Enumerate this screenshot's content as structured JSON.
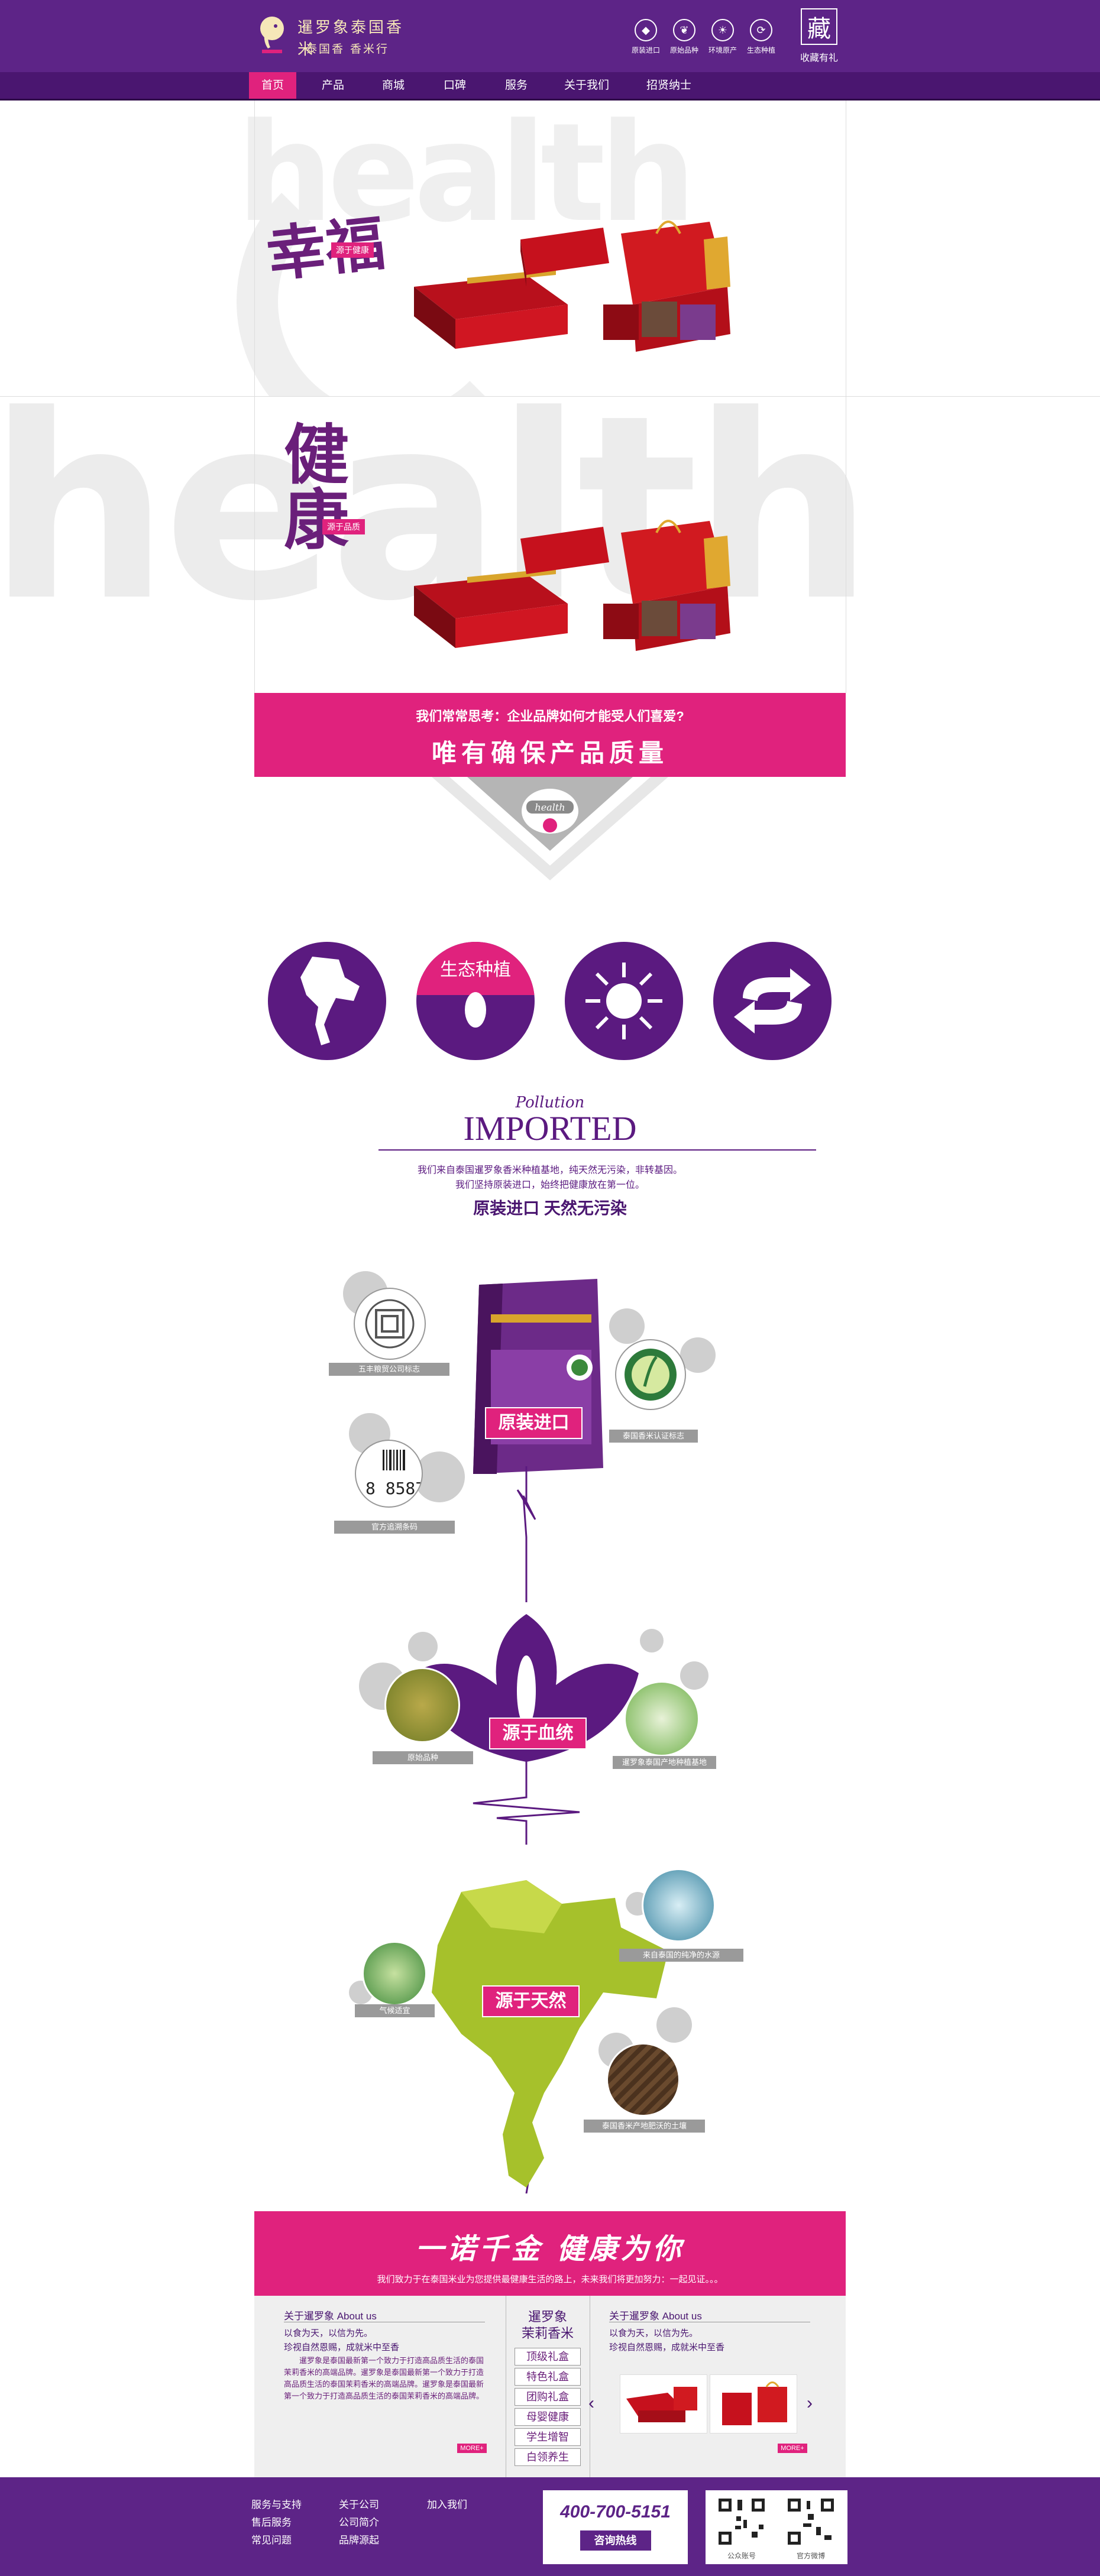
{
  "header": {
    "logo_title": "暹罗象泰国香米",
    "logo_sub": "泰国香 香米行",
    "icons": [
      {
        "icon": "rice-icon",
        "label": "原装进口"
      },
      {
        "icon": "leaf-icon",
        "label": "原始品种"
      },
      {
        "icon": "sun-icon",
        "label": "环境原产"
      },
      {
        "icon": "cycle-icon",
        "label": "生态种植"
      }
    ],
    "fav_glyph": "藏",
    "fav_label": "收藏有礼"
  },
  "nav": [
    "首页",
    "产品",
    "商城",
    "口碑",
    "服务",
    "关于我们",
    "招贤纳士"
  ],
  "banner1": {
    "bg_text": "health",
    "calligraphy": "幸福",
    "tag": "源于健康"
  },
  "banner2": {
    "bg_text": "health",
    "calligraphy": "健康",
    "tag": "源于品质"
  },
  "slogan": {
    "line1": "我们常常思考：企业品牌如何才能受人们喜爱?",
    "line2": "唯有确保产品质量"
  },
  "badge_text": "health",
  "circles": [
    {
      "icon": "thailand-map-icon",
      "label": ""
    },
    {
      "icon": "rice-grain-icon",
      "label": "生态种植"
    },
    {
      "icon": "sun-icon",
      "label": ""
    },
    {
      "icon": "recycle-arrows-icon",
      "label": ""
    }
  ],
  "imported": {
    "script": "Pollution",
    "title": "IMPORTED",
    "desc1": "我们来自泰国暹罗象香米种植基地，纯天然无污染，非转基因。",
    "desc2": "我们坚持原装进口，始终把健康放在第一位。",
    "headline": "原装进口 天然无污染"
  },
  "flow": {
    "sec1_button": "原装进口",
    "sec1_labels": [
      "五丰粮贸公司标志",
      "泰国香米认证标志",
      "官方追溯条码"
    ],
    "barcode_number": "8 8587",
    "sec2_button": "源于血统",
    "sec2_labels": [
      "原始品种",
      "暹罗象泰国产地种植基地"
    ],
    "sec3_button": "源于天然",
    "sec3_labels": [
      "来自泰国的纯净的水源",
      "气候适宜",
      "泰国香米产地肥沃的土壤"
    ]
  },
  "bottom_banner": {
    "title": "一诺千金 健康为你",
    "sub": "我们致力于在泰国米业为您提供最健康生活的路上，未来我们将更加努力：一起见证。。。"
  },
  "about_left": {
    "title": "关于暹罗象 About us",
    "line1": "以食为天，以信为先。",
    "line2": "珍视自然恩赐，成就米中至香",
    "para": "暹罗象是泰国最新第一个致力于打造高品质生活的泰国茉莉香米的高端品牌。暹罗象是泰国最新第一个致力于打造高品质生活的泰国茉莉香米的高端品牌。暹罗象是泰国最新第一个致力于打造高品质生活的泰国茉莉香米的高端品牌。",
    "more": "MORE+"
  },
  "menu": {
    "title1": "暹罗象",
    "title2": "茉莉香米",
    "items": [
      "顶级礼盒",
      "特色礼盒",
      "团购礼盒",
      "母婴健康",
      "学生增智",
      "白领养生"
    ]
  },
  "about_right": {
    "title": "关于暹罗象 About us",
    "line1": "以食为天，以信为先。",
    "line2": "珍视自然恩赐，成就米中至香",
    "more": "MORE+"
  },
  "footer": {
    "col1": [
      "服务与支持",
      "售后服务",
      "常见问题"
    ],
    "col2": [
      "关于公司",
      "公司简介",
      "品牌源起"
    ],
    "col3": [
      "加入我们"
    ],
    "phone": "400-700-5151",
    "consult": "咨询热线",
    "qr1_label": "公众账号",
    "qr2_label": "官方微博"
  },
  "colors": {
    "purple": "#5d2487",
    "pink": "#e0227d",
    "dark_purple": "#4a1670"
  }
}
